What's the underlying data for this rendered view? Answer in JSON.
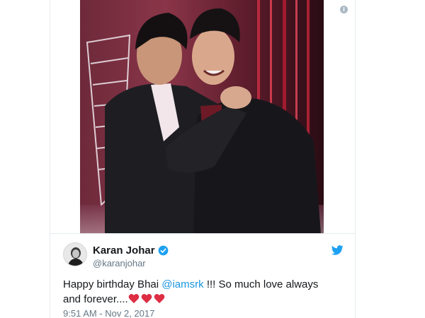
{
  "tweet": {
    "author_name": "Karan Johar",
    "author_handle": "@karanjohar",
    "text_before": "Happy birthday Bhai ",
    "mention": "@iamsrk",
    "text_after": " !!! So much love always and forever....",
    "hearts_count": 3,
    "timestamp": "9:51 AM - Nov 2, 2017"
  },
  "icons": {
    "verified": "verified-badge-icon",
    "platform": "twitter-bird-icon",
    "info": "info-icon",
    "heart": "red-heart-icon"
  },
  "colors": {
    "link": "#1b95e0",
    "verified": "#1da1f2",
    "heart": "#dd2e44",
    "text": "#14171a",
    "muted": "#657786"
  }
}
